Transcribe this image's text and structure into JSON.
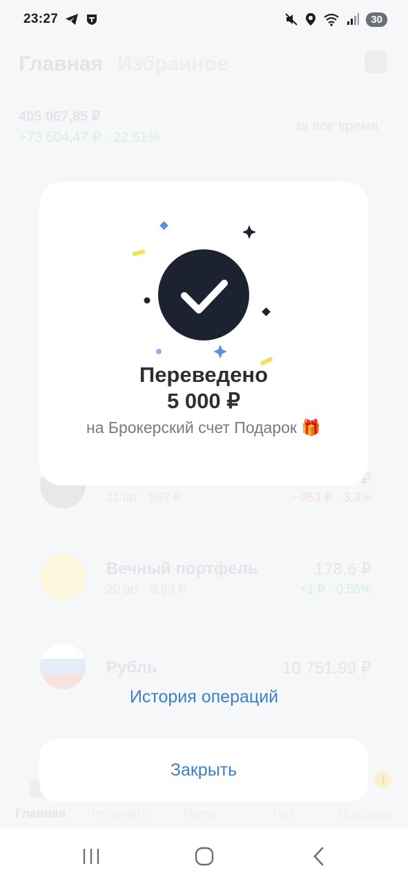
{
  "status_bar": {
    "time": "23:27",
    "battery": "30",
    "left_icons": [
      "telegram-icon",
      "tinkoff-icon"
    ],
    "right_icons": [
      "mute-icon",
      "location-icon",
      "wifi-icon",
      "signal-icon"
    ]
  },
  "background": {
    "tabs": [
      "Главная",
      "Избранное"
    ],
    "portfolio_total": "405 067,85 ₽",
    "portfolio_delta": "+73 504,47 ₽ · 22,51%",
    "period": "за все время",
    "assets": [
      {
        "name": "",
        "sub": "11 шт · 967 ₽",
        "value": "₽",
        "delta": "−363 ₽ · 3,3%"
      },
      {
        "name": "Вечный портфель",
        "sub": "20 шт · 8,93 ₽",
        "value": "178,6 ₽",
        "delta": "+1 ₽ · 0,56%"
      },
      {
        "name": "Рубль",
        "sub": "",
        "value": "10 751,99 ₽",
        "delta": ""
      }
    ],
    "bottom_nav": [
      "Главная",
      "Что купить",
      "Пульс",
      "Чат",
      "Профиль"
    ],
    "profile_badge": "1"
  },
  "modal": {
    "title": "Переведено",
    "amount": "5 000 ₽",
    "description": "на Брокерский счет Подарок 🎁",
    "history_link": "История операций",
    "close_button": "Закрыть"
  },
  "colors": {
    "accent_link": "#3d7fc6",
    "check_circle": "#1c2230",
    "confetti_blue": "#5b8fe0",
    "confetti_yellow": "#f5e05a"
  }
}
